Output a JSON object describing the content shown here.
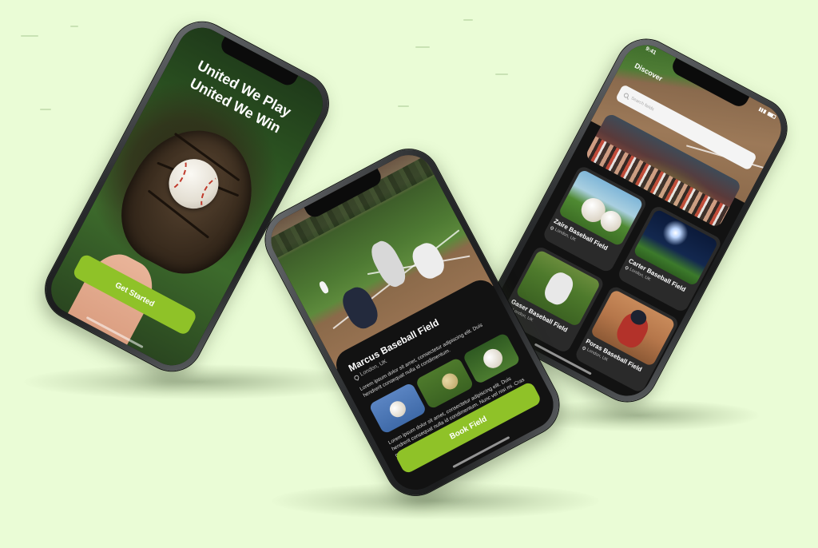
{
  "colors": {
    "background": "#eafcd6",
    "accent": "#8fc228",
    "screen_dark": "#121212"
  },
  "onboarding": {
    "headline_line1": "United We Play",
    "headline_line2": "United We Win",
    "cta_label": "Get Started"
  },
  "field_detail": {
    "title": "Marcus Baseball Field",
    "location": "London, UK",
    "description_1": "Lorem ipsum dolor sit amet, consectetur adipiscing elit. Duis hendrerit consequat nulla id condimentum.",
    "description_2": "Lorem ipsum dolor sit amet, consectetur adipiscing elit. Duis hendrerit consequat nulla id condimentum. Nunc vel nisi mi. Cras maximus finibus dui nec vestibulum.",
    "book_label": "Book Field"
  },
  "discover": {
    "status_time": "9:41",
    "title": "Discover",
    "search_placeholder": "Search fields",
    "fields": [
      {
        "name": "Zaire Baseball Field",
        "location": "London, UK"
      },
      {
        "name": "Carter Baseball Field",
        "location": "London, UK"
      },
      {
        "name": "Gaser Baseball Field",
        "location": "London, UK"
      },
      {
        "name": "Poras Baseball Field",
        "location": "London, UK"
      }
    ]
  }
}
